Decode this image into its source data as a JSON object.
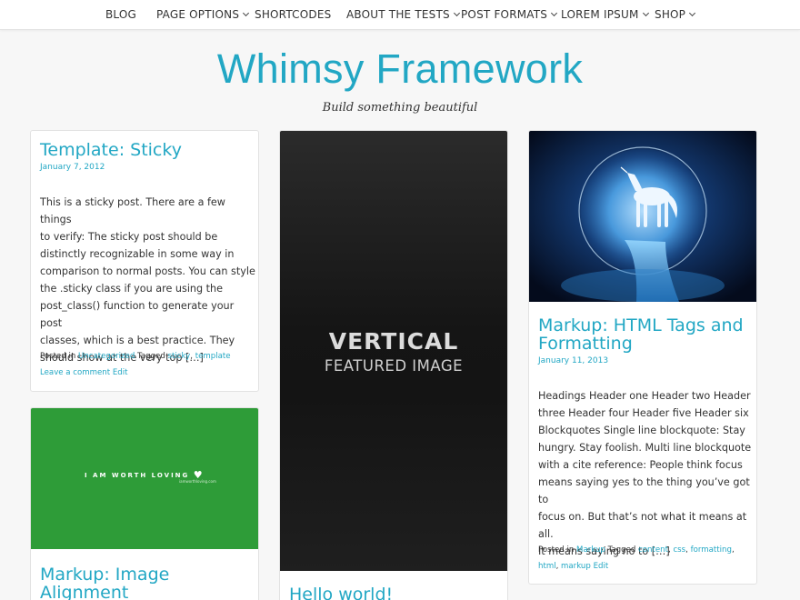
{
  "nav": {
    "items": [
      {
        "label": "BLOG",
        "has_dropdown": false
      },
      {
        "label": "PAGE OPTIONS",
        "has_dropdown": true
      },
      {
        "label": "SHORTCODES",
        "has_dropdown": false
      },
      {
        "label": "ABOUT THE TESTS",
        "has_dropdown": true
      },
      {
        "label": "POST FORMATS",
        "has_dropdown": true
      },
      {
        "label": "LOREM IPSUM",
        "has_dropdown": true
      },
      {
        "label": "SHOP",
        "has_dropdown": true
      }
    ]
  },
  "site": {
    "title": "Whimsy Framework",
    "description": "Build something beautiful"
  },
  "colors": {
    "accent": "#22a7c4",
    "background": "#f7f7f7",
    "green_image": "#2e9c38"
  },
  "posts": {
    "sticky": {
      "title": "Template: Sticky",
      "date": "January 7, 2012",
      "excerpt_lines": [
        "This is a sticky post. There are a few things",
        "to verify: The sticky post should be",
        "distinctly recognizable in some way in",
        "comparison to normal posts. You can style",
        "the .sticky class if you are using the",
        "post_class() function to generate your post",
        "classes, which is a best practice. They",
        "should show at the very top […]"
      ],
      "posted_in_label": "Posted in",
      "category": "Uncategorized",
      "tagged_label": "Tagged",
      "tags": [
        "sticky",
        "template"
      ],
      "comment_link": "Leave a comment",
      "edit_link": "Edit"
    },
    "image_alignment": {
      "title_lines": [
        "Markup: Image",
        "Alignment"
      ],
      "image_text": "I AM WORTH LOVING",
      "image_small_text": "iamworthloving.com"
    },
    "hello_world": {
      "title": "Hello world!",
      "image_text_bold": "VERTICAL",
      "image_text_sub": "FEATURED IMAGE"
    },
    "html_tags": {
      "title_lines": [
        "Markup: HTML Tags and",
        "Formatting"
      ],
      "date": "January 11, 2013",
      "excerpt_lines": [
        "Headings Header one Header two Header",
        "three Header four Header five Header six",
        "Blockquotes Single line blockquote: Stay",
        "hungry. Stay foolish. Multi line blockquote",
        "with a cite reference: People think focus",
        "means saying yes to the thing you’ve got to",
        "focus on. But that’s not what it means at all.",
        "It means saying no to […]"
      ],
      "posted_in_label": "Posted in",
      "category": "Markup",
      "tagged_label": "Tagged",
      "tags": [
        "content",
        "css",
        "formatting",
        "html",
        "markup"
      ],
      "edit_link": "Edit"
    }
  }
}
